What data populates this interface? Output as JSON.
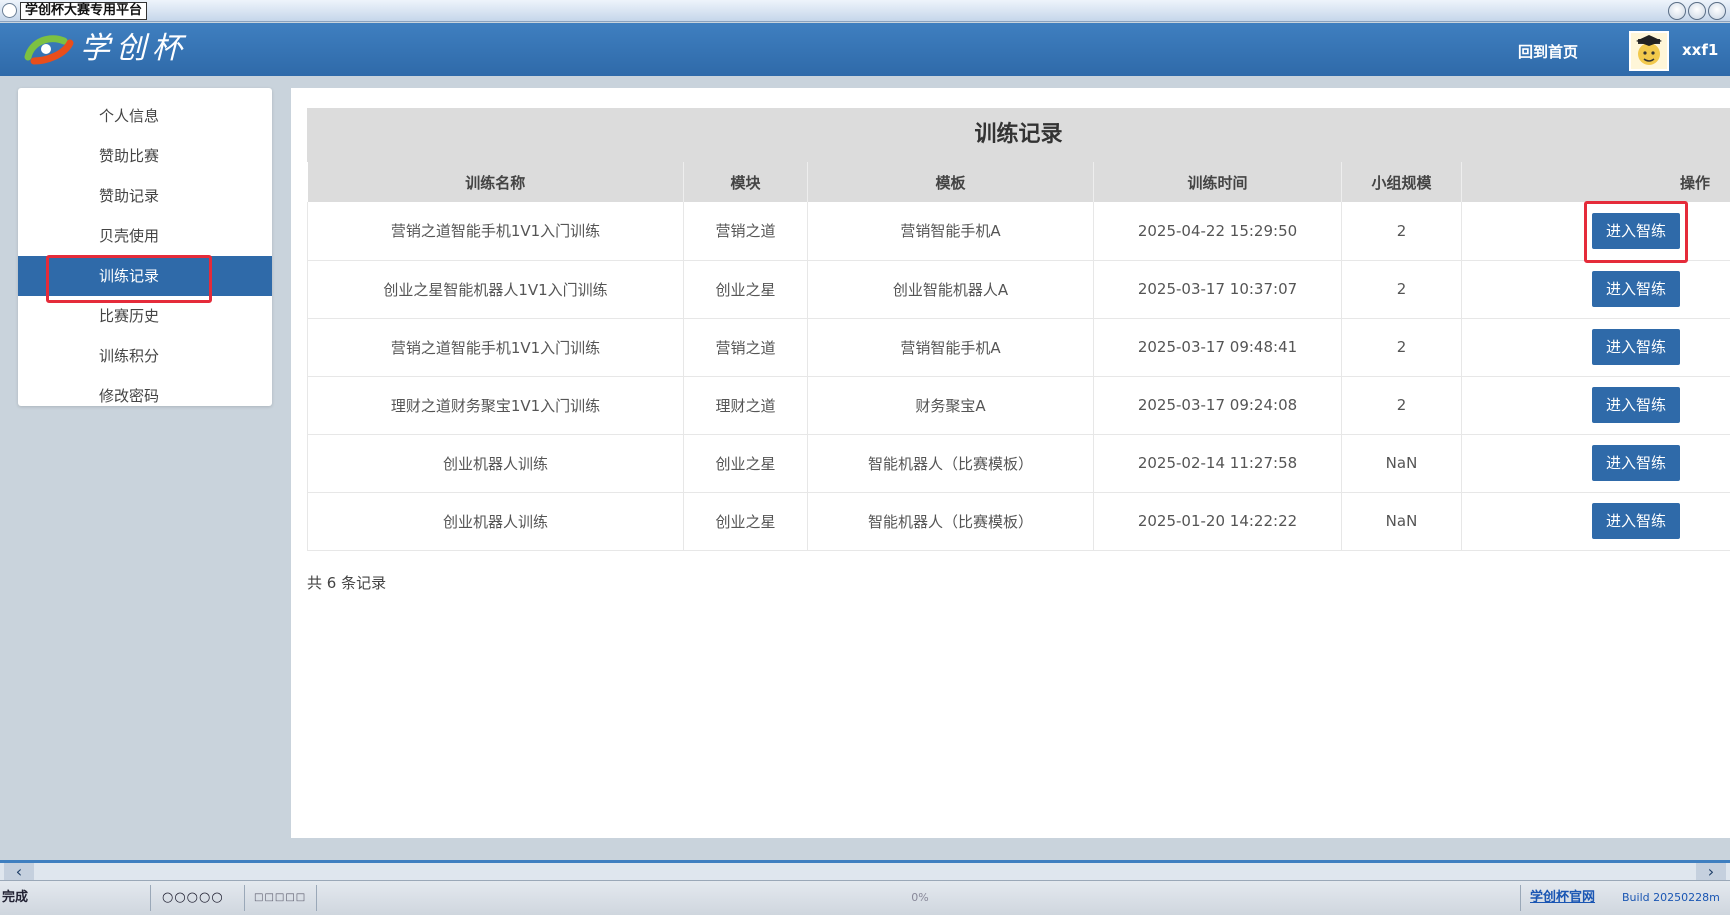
{
  "window": {
    "title": "学创杯大赛专用平台"
  },
  "header": {
    "logo_text": "学创杯",
    "home_link": "回到首页",
    "username": "xxf1"
  },
  "sidebar": {
    "items": [
      {
        "label": "个人信息"
      },
      {
        "label": "赞助比赛"
      },
      {
        "label": "赞助记录"
      },
      {
        "label": "贝壳使用"
      },
      {
        "label": "训练记录"
      },
      {
        "label": "比赛历史"
      },
      {
        "label": "训练积分"
      },
      {
        "label": "修改密码"
      }
    ]
  },
  "main": {
    "title": "训练记录",
    "columns": [
      "训练名称",
      "模块",
      "模板",
      "训练时间",
      "小组规模",
      "操作"
    ],
    "rows": [
      {
        "name": "营销之道智能手机1V1入门训练",
        "module": "营销之道",
        "template": "营销智能手机A",
        "time": "2025-04-22 15:29:50",
        "size": "2",
        "action": "进入智练"
      },
      {
        "name": "创业之星智能机器人1V1入门训练",
        "module": "创业之星",
        "template": "创业智能机器人A",
        "time": "2025-03-17 10:37:07",
        "size": "2",
        "action": "进入智练"
      },
      {
        "name": "营销之道智能手机1V1入门训练",
        "module": "营销之道",
        "template": "营销智能手机A",
        "time": "2025-03-17 09:48:41",
        "size": "2",
        "action": "进入智练"
      },
      {
        "name": "理财之道财务聚宝1V1入门训练",
        "module": "理财之道",
        "template": "财务聚宝A",
        "time": "2025-03-17 09:24:08",
        "size": "2",
        "action": "进入智练"
      },
      {
        "name": "创业机器人训练",
        "module": "创业之星",
        "template": "智能机器人（比赛模板）",
        "time": "2025-02-14 11:27:58",
        "size": "NaN",
        "action": "进入智练"
      },
      {
        "name": "创业机器人训练",
        "module": "创业之星",
        "template": "智能机器人（比赛模板）",
        "time": "2025-01-20 14:22:22",
        "size": "NaN",
        "action": "进入智练"
      }
    ],
    "record_count": "共 6 条记录"
  },
  "statusbar": {
    "status": "完成",
    "dots1": "○○○○○",
    "dots2": "□□□□□",
    "progress": "0%",
    "site_link": "学创杯官网",
    "build": "Build 20250228m"
  },
  "colors": {
    "accent": "#2f6aa9",
    "highlight": "#e52b3a"
  }
}
